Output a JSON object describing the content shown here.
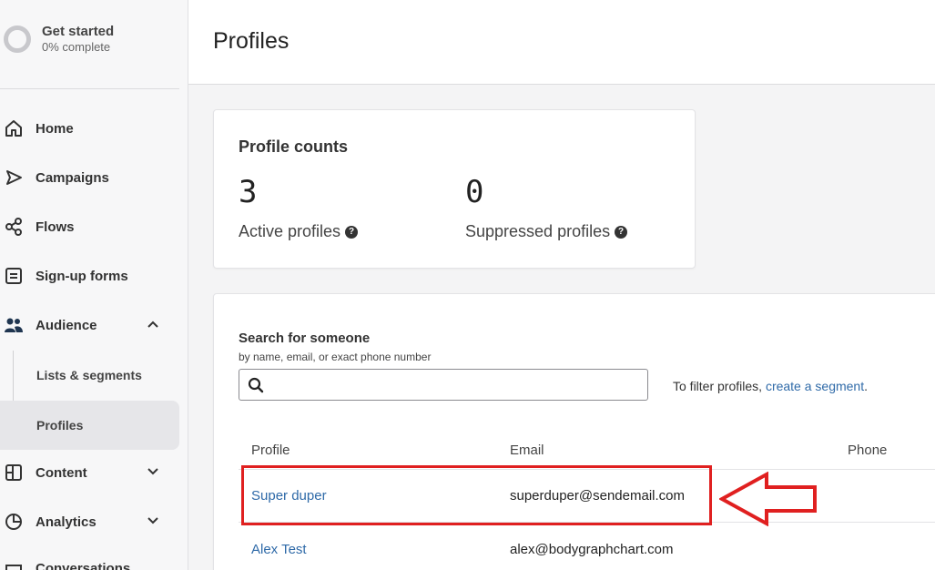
{
  "sidebar": {
    "get_started": {
      "title": "Get started",
      "progress": "0% complete"
    },
    "items": [
      {
        "label": "Home",
        "icon": "home-icon"
      },
      {
        "label": "Campaigns",
        "icon": "send-icon"
      },
      {
        "label": "Flows",
        "icon": "flows-icon"
      },
      {
        "label": "Sign-up forms",
        "icon": "form-icon"
      },
      {
        "label": "Audience",
        "icon": "users-icon",
        "expanded": true
      },
      {
        "label": "Content",
        "icon": "content-icon"
      },
      {
        "label": "Analytics",
        "icon": "analytics-icon"
      },
      {
        "label": "Conversations",
        "icon": "chat-icon"
      }
    ],
    "audience_sub": [
      {
        "label": "Lists & segments"
      },
      {
        "label": "Profiles",
        "active": true
      }
    ]
  },
  "header": {
    "title": "Profiles"
  },
  "profile_counts": {
    "title": "Profile counts",
    "active": {
      "count": "3",
      "label": "Active profiles"
    },
    "suppressed": {
      "count": "0",
      "label": "Suppressed profiles"
    }
  },
  "search": {
    "title": "Search for someone",
    "subtitle": "by name, email, or exact phone number",
    "value": "",
    "filter_prefix": "To filter profiles,",
    "filter_link": "create a segment",
    "filter_suffix": "."
  },
  "table": {
    "columns": [
      "Profile",
      "Email",
      "Phone"
    ],
    "rows": [
      {
        "name": "Super duper",
        "email": "superduper@sendemail.com",
        "phone": ""
      },
      {
        "name": "Alex Test",
        "email": "alex@bodygraphchart.com",
        "phone": ""
      }
    ]
  },
  "colors": {
    "link": "#2f6aa8",
    "highlight": "#e02020"
  }
}
